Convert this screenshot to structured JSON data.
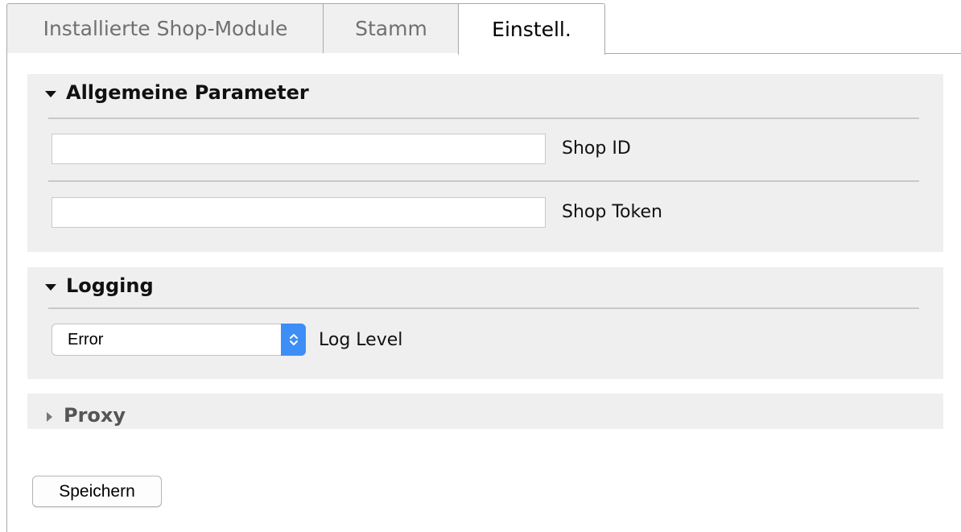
{
  "tabs": [
    {
      "label": "Installierte Shop-Module",
      "active": false
    },
    {
      "label": "Stamm",
      "active": false
    },
    {
      "label": "Einstell.",
      "active": true
    }
  ],
  "groups": {
    "general": {
      "title": "Allgemeine Parameter",
      "expanded": true,
      "fields": [
        {
          "label": "Shop ID",
          "value": ""
        },
        {
          "label": "Shop Token",
          "value": ""
        }
      ]
    },
    "logging": {
      "title": "Logging",
      "expanded": true,
      "log_level": {
        "label": "Log Level",
        "value": "Error"
      }
    },
    "proxy": {
      "title": "Proxy",
      "expanded": false
    }
  },
  "save_label": "Speichern",
  "icons": {
    "expanded": "caret-down-icon",
    "collapsed": "caret-right-icon",
    "select": "chevron-up-down-icon"
  },
  "colors": {
    "group_background": "#efefef",
    "select_accent": "#3d8ef6"
  }
}
